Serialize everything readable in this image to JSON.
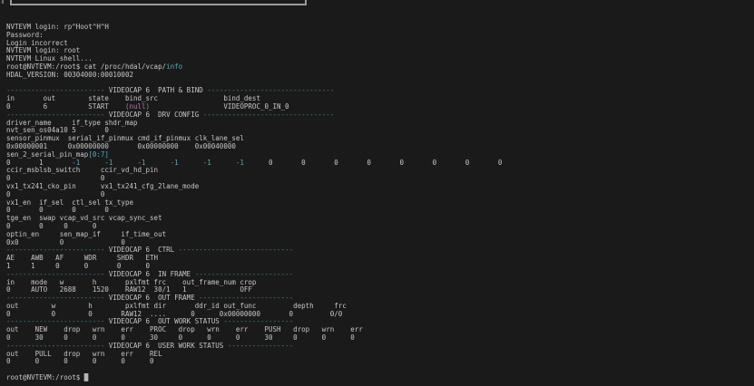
{
  "colors": {
    "bg": "#1a1a1b",
    "fg": "#c7c7c7",
    "cyan": "#4fadbc",
    "cyan_dim": "#3f8795",
    "magenta": "#ad74a5",
    "cursor": "#b5b5b5",
    "box_border": "#9b9b9b"
  },
  "terminal": {
    "prompt": "root@NVTEVM:/root$",
    "lines": [
      [
        {
          "t": "NVTEVM login: rp^Hoot^H^H"
        }
      ],
      [
        {
          "t": "Password:"
        }
      ],
      [
        {
          "t": "Login incorrect"
        }
      ],
      [
        {
          "t": "NVTEVM login: root"
        }
      ],
      [
        {
          "t": "NVTEVM Linux shell..."
        }
      ],
      [
        {
          "t": "root@NVTEVM:/root$ cat /proc/hdal/vcap/"
        },
        {
          "t": "info",
          "c": "cy"
        }
      ],
      [
        {
          "t": "HDAL_VERSION: 00304000:00010002"
        }
      ],
      [],
      [
        {
          "t": "------------------------",
          "c": "cyd"
        },
        {
          "t": " VIDEOCAP 6  PATH & BIND "
        },
        {
          "t": "-------------------------------",
          "c": "cyd"
        }
      ],
      [
        {
          "t": "in       out        state    bind_src                bind_dest"
        }
      ],
      [
        {
          "t": "0        6          START    "
        },
        {
          "t": "(null)",
          "c": "mg"
        },
        {
          "t": "                  VIDEOPROC_0_IN_0"
        }
      ],
      [
        {
          "t": "------------------------",
          "c": "cyd"
        },
        {
          "t": " VIDEOCAP 6  DRV CONFIG "
        },
        {
          "t": "--------------------------------",
          "c": "cyd"
        }
      ],
      [
        {
          "t": "driver_name     if_type shdr_map"
        }
      ],
      [
        {
          "t": "nvt_sen_os04a10 5       0"
        }
      ],
      [
        {
          "t": "sensor_pinmux  serial_if_pinmux cmd_if_pinmux clk_lane_sel"
        }
      ],
      [
        {
          "t": "0x00000001     0x00000000       0x00000000    0x00040000"
        }
      ],
      [
        {
          "t": "sen_2_serial_pin_map"
        },
        {
          "t": "[0:7]",
          "c": "cy"
        }
      ],
      [
        {
          "t": "0       1       "
        },
        {
          "t": "-1      -1      -1      -1      -1      -1      ",
          "c": "cy"
        },
        {
          "t": "0       0       0       0       0       0       0       0"
        }
      ],
      [
        {
          "t": "ccir_msblsb_switch     ccir_vd_hd_pin"
        }
      ],
      [
        {
          "t": "0                      0"
        }
      ],
      [
        {
          "t": "vx1_tx241_cko_pin      vx1_tx241_cfg_2lane_mode"
        }
      ],
      [
        {
          "t": "0                      0"
        }
      ],
      [
        {
          "t": "vx1_en  if_sel  ctl_sel tx_type"
        }
      ],
      [
        {
          "t": "0       0       0       0"
        }
      ],
      [
        {
          "t": "tge_en  swap vcap_vd_src vcap_sync_set"
        }
      ],
      [
        {
          "t": "0       0     0      0"
        }
      ],
      [
        {
          "t": "optin_en     sen_map_if     if_time_out"
        }
      ],
      [
        {
          "t": "0x0          0              0"
        }
      ],
      [
        {
          "t": "------------------------",
          "c": "cyd"
        },
        {
          "t": " VIDEOCAP 6  CTRL "
        },
        {
          "t": "----------------------------",
          "c": "cyd"
        }
      ],
      [
        {
          "t": "AE    AWB   AF     WDR     SHDR   ETH"
        }
      ],
      [
        {
          "t": "1     1     0      0       0      0"
        }
      ],
      [
        {
          "t": "------------------------",
          "c": "cyd"
        },
        {
          "t": " VIDEOCAP 6  IN FRAME "
        },
        {
          "t": "------------------------",
          "c": "cyd"
        }
      ],
      [
        {
          "t": "in    mode   w       h       pxlfmt frc    out_frame_num crop"
        }
      ],
      [
        {
          "t": "0     AUTO   2688    1520    RAW12  30/1   1             OFF"
        }
      ],
      [
        {
          "t": "------------------------",
          "c": "cyd"
        },
        {
          "t": " VIDEOCAP 6  OUT FRAME "
        },
        {
          "t": "-----------------------",
          "c": "cyd"
        }
      ],
      [
        {
          "t": "out        w        h        pxlfmt dir       ddr_id out_func         depth     frc"
        }
      ],
      [
        {
          "t": "0          0        0       RAW12  ....      0      0x00000000       0         0/0"
        }
      ],
      [
        {
          "t": "------------------------",
          "c": "cyd"
        },
        {
          "t": " VIDEOCAP 6  OUT WORK STATUS "
        },
        {
          "t": "-----------------",
          "c": "cyd"
        }
      ],
      [
        {
          "t": "out    NEW    drop   wrn    err    PROC   drop   wrn    err    PUSH   drop   wrn    err"
        }
      ],
      [
        {
          "t": "0      30     0      0      0      30     0      0      0      30     0      0      0"
        }
      ],
      [
        {
          "t": "------------------------",
          "c": "cyd"
        },
        {
          "t": " VIDEOCAP 6  USER WORK STATUS "
        },
        {
          "t": "----------------",
          "c": "cyd"
        }
      ],
      [
        {
          "t": "out    PULL   drop   wrn    err    REL"
        }
      ],
      [
        {
          "t": "0      0      0      0      0      0"
        }
      ],
      [],
      [
        {
          "t": "root@NVTEVM:/root$ "
        },
        {
          "t": "█",
          "c": "cur",
          "n": "cursor"
        }
      ]
    ]
  }
}
